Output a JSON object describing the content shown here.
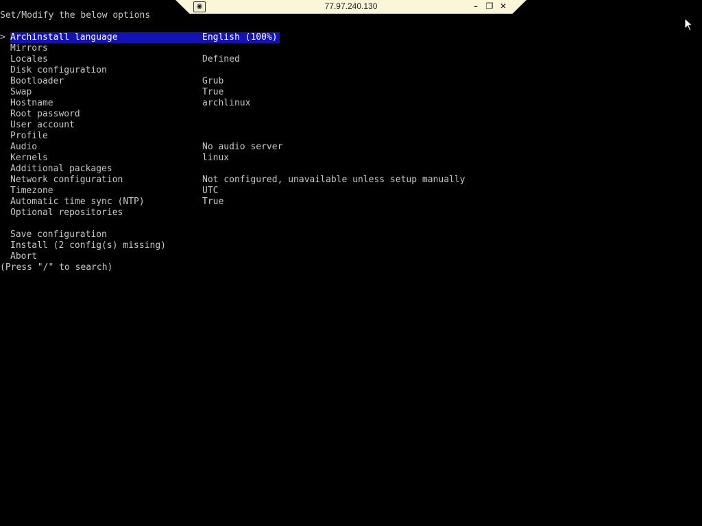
{
  "header": {
    "title": "Set/Modify the below options"
  },
  "menu": {
    "cursor_glyph": ">",
    "items": [
      {
        "label": "Archinstall language",
        "value": "English (100%)"
      },
      {
        "label": "Mirrors",
        "value": ""
      },
      {
        "label": "Locales",
        "value": "Defined"
      },
      {
        "label": "Disk configuration",
        "value": ""
      },
      {
        "label": "Bootloader",
        "value": "Grub"
      },
      {
        "label": "Swap",
        "value": "True"
      },
      {
        "label": "Hostname",
        "value": "archlinux"
      },
      {
        "label": "Root password",
        "value": ""
      },
      {
        "label": "User account",
        "value": ""
      },
      {
        "label": "Profile",
        "value": ""
      },
      {
        "label": "Audio",
        "value": "No audio server"
      },
      {
        "label": "Kernels",
        "value": "linux"
      },
      {
        "label": "Additional packages",
        "value": ""
      },
      {
        "label": "Network configuration",
        "value": "Not configured, unavailable unless setup manually"
      },
      {
        "label": "Timezone",
        "value": "UTC"
      },
      {
        "label": "Automatic time sync (NTP)",
        "value": "True"
      },
      {
        "label": "Optional repositories",
        "value": ""
      }
    ],
    "actions": [
      {
        "label": "Save configuration"
      },
      {
        "label": "Install (2 config(s) missing)"
      },
      {
        "label": "Abort"
      }
    ],
    "selected_index": 0
  },
  "footer": {
    "hint": "(Press \"/\" to search)"
  },
  "remote_toolbar": {
    "host": "77.97.240.130",
    "pin_icon": "pin-icon",
    "minimize_icon": "minimize-icon",
    "restore_icon": "restore-icon",
    "close_icon": "close-icon"
  },
  "colors": {
    "background": "#000000",
    "text": "#c8c8c8",
    "selection": "#1212b8",
    "toolbar": "#fbf6d8"
  }
}
